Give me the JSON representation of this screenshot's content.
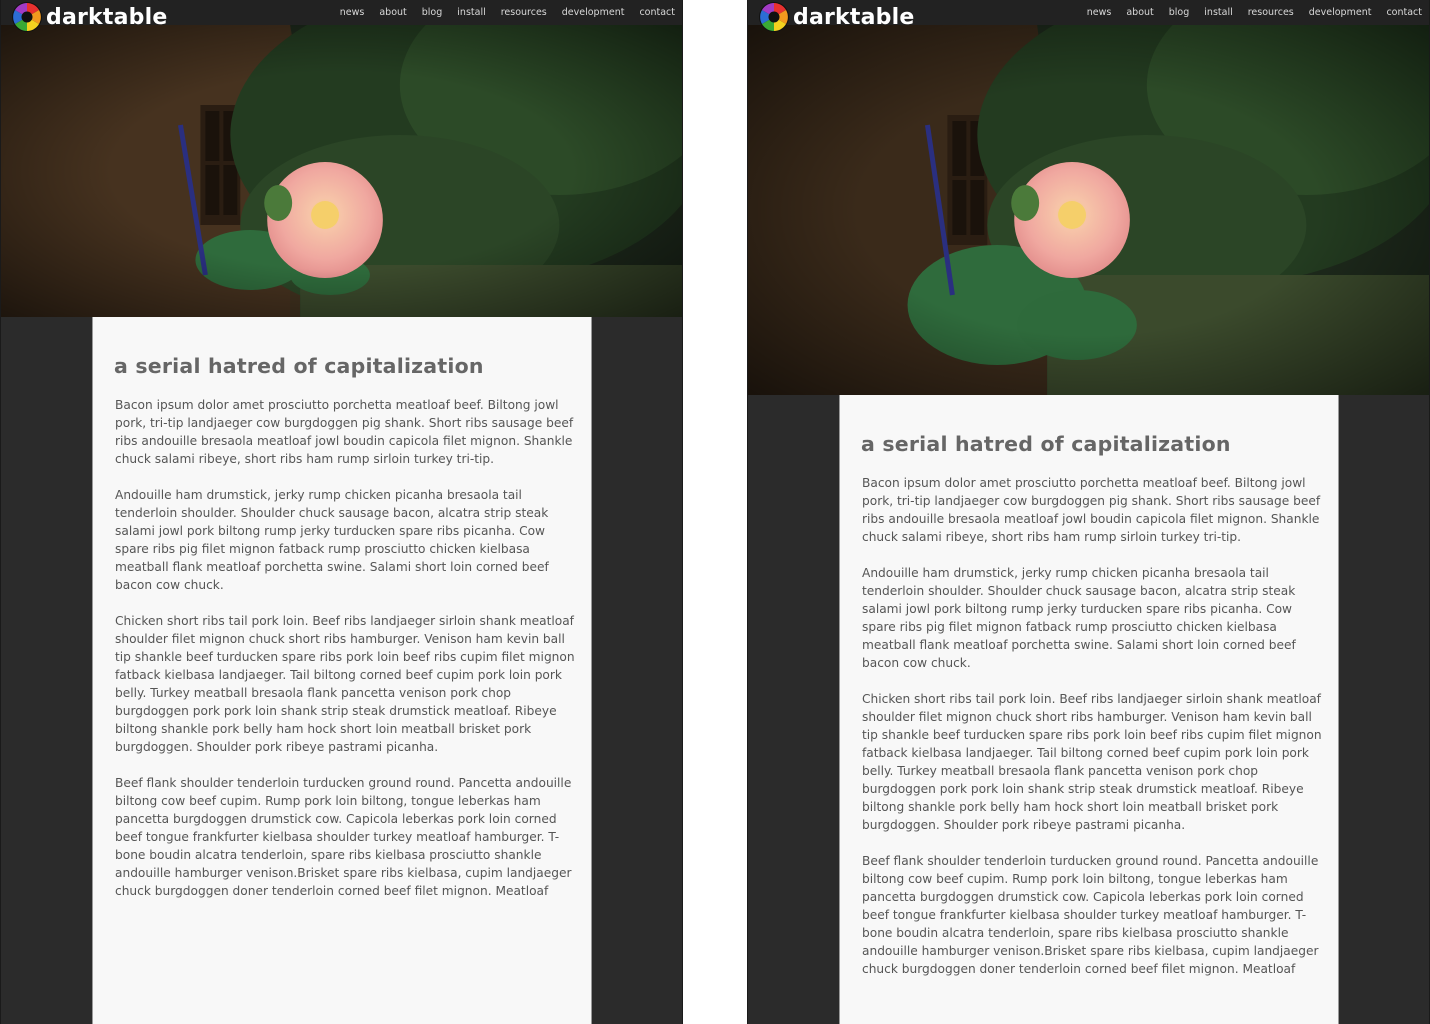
{
  "site": {
    "logo_text": "darktable",
    "nav": [
      "news",
      "about",
      "blog",
      "install",
      "resources",
      "development",
      "contact"
    ]
  },
  "article": {
    "title": "a serial hatred of capitalization",
    "paragraphs": [
      "Bacon ipsum dolor amet prosciutto porchetta meatloaf beef. Biltong jowl pork, tri-tip landjaeger cow burgdoggen pig shank. Short ribs sausage beef ribs andouille bresaola meatloaf jowl boudin capicola filet mignon. Shankle chuck salami ribeye, short ribs ham rump sirloin turkey tri-tip.",
      "Andouille ham drumstick, jerky rump chicken picanha bresaola tail tenderloin shoulder. Shoulder chuck sausage bacon, alcatra strip steak salami jowl pork biltong rump jerky turducken spare ribs picanha. Cow spare ribs pig filet mignon fatback rump prosciutto chicken kielbasa meatball flank meatloaf porchetta swine. Salami short loin corned beef bacon cow chuck.",
      "Chicken short ribs tail pork loin. Beef ribs landjaeger sirloin shank meatloaf shoulder filet mignon chuck short ribs hamburger. Venison ham kevin ball tip shankle beef turducken spare ribs pork loin beef ribs cupim filet mignon fatback kielbasa landjaeger. Tail biltong corned beef cupim pork loin pork belly. Turkey meatball bresaola flank pancetta venison pork chop burgdoggen pork pork loin shank strip steak drumstick meatloaf. Ribeye biltong shankle pork belly ham hock short loin meatball brisket pork burgdoggen. Shoulder pork ribeye pastrami picanha.",
      "Beef flank shoulder tenderloin turducken ground round. Pancetta andouille biltong cow beef cupim. Rump pork loin biltong, tongue leberkas ham pancetta burgdoggen drumstick cow. Capicola leberkas pork loin corned beef tongue frankfurter kielbasa shoulder turkey meatloaf hamburger. T-bone boudin alcatra tenderloin, spare ribs kielbasa prosciutto shankle andouille hamburger venison.Brisket spare ribs kielbasa, cupim landjaeger chuck burgdoggen doner tenderloin corned beef filet mignon. Meatloaf"
    ]
  },
  "colors": {
    "page_background": "#2b2b2b",
    "topbar": "#222222",
    "content_background": "#f8f8f8",
    "heading": "#666666",
    "body_text": "#555555"
  },
  "icons": [
    "darktable-aperture-logo-icon"
  ]
}
